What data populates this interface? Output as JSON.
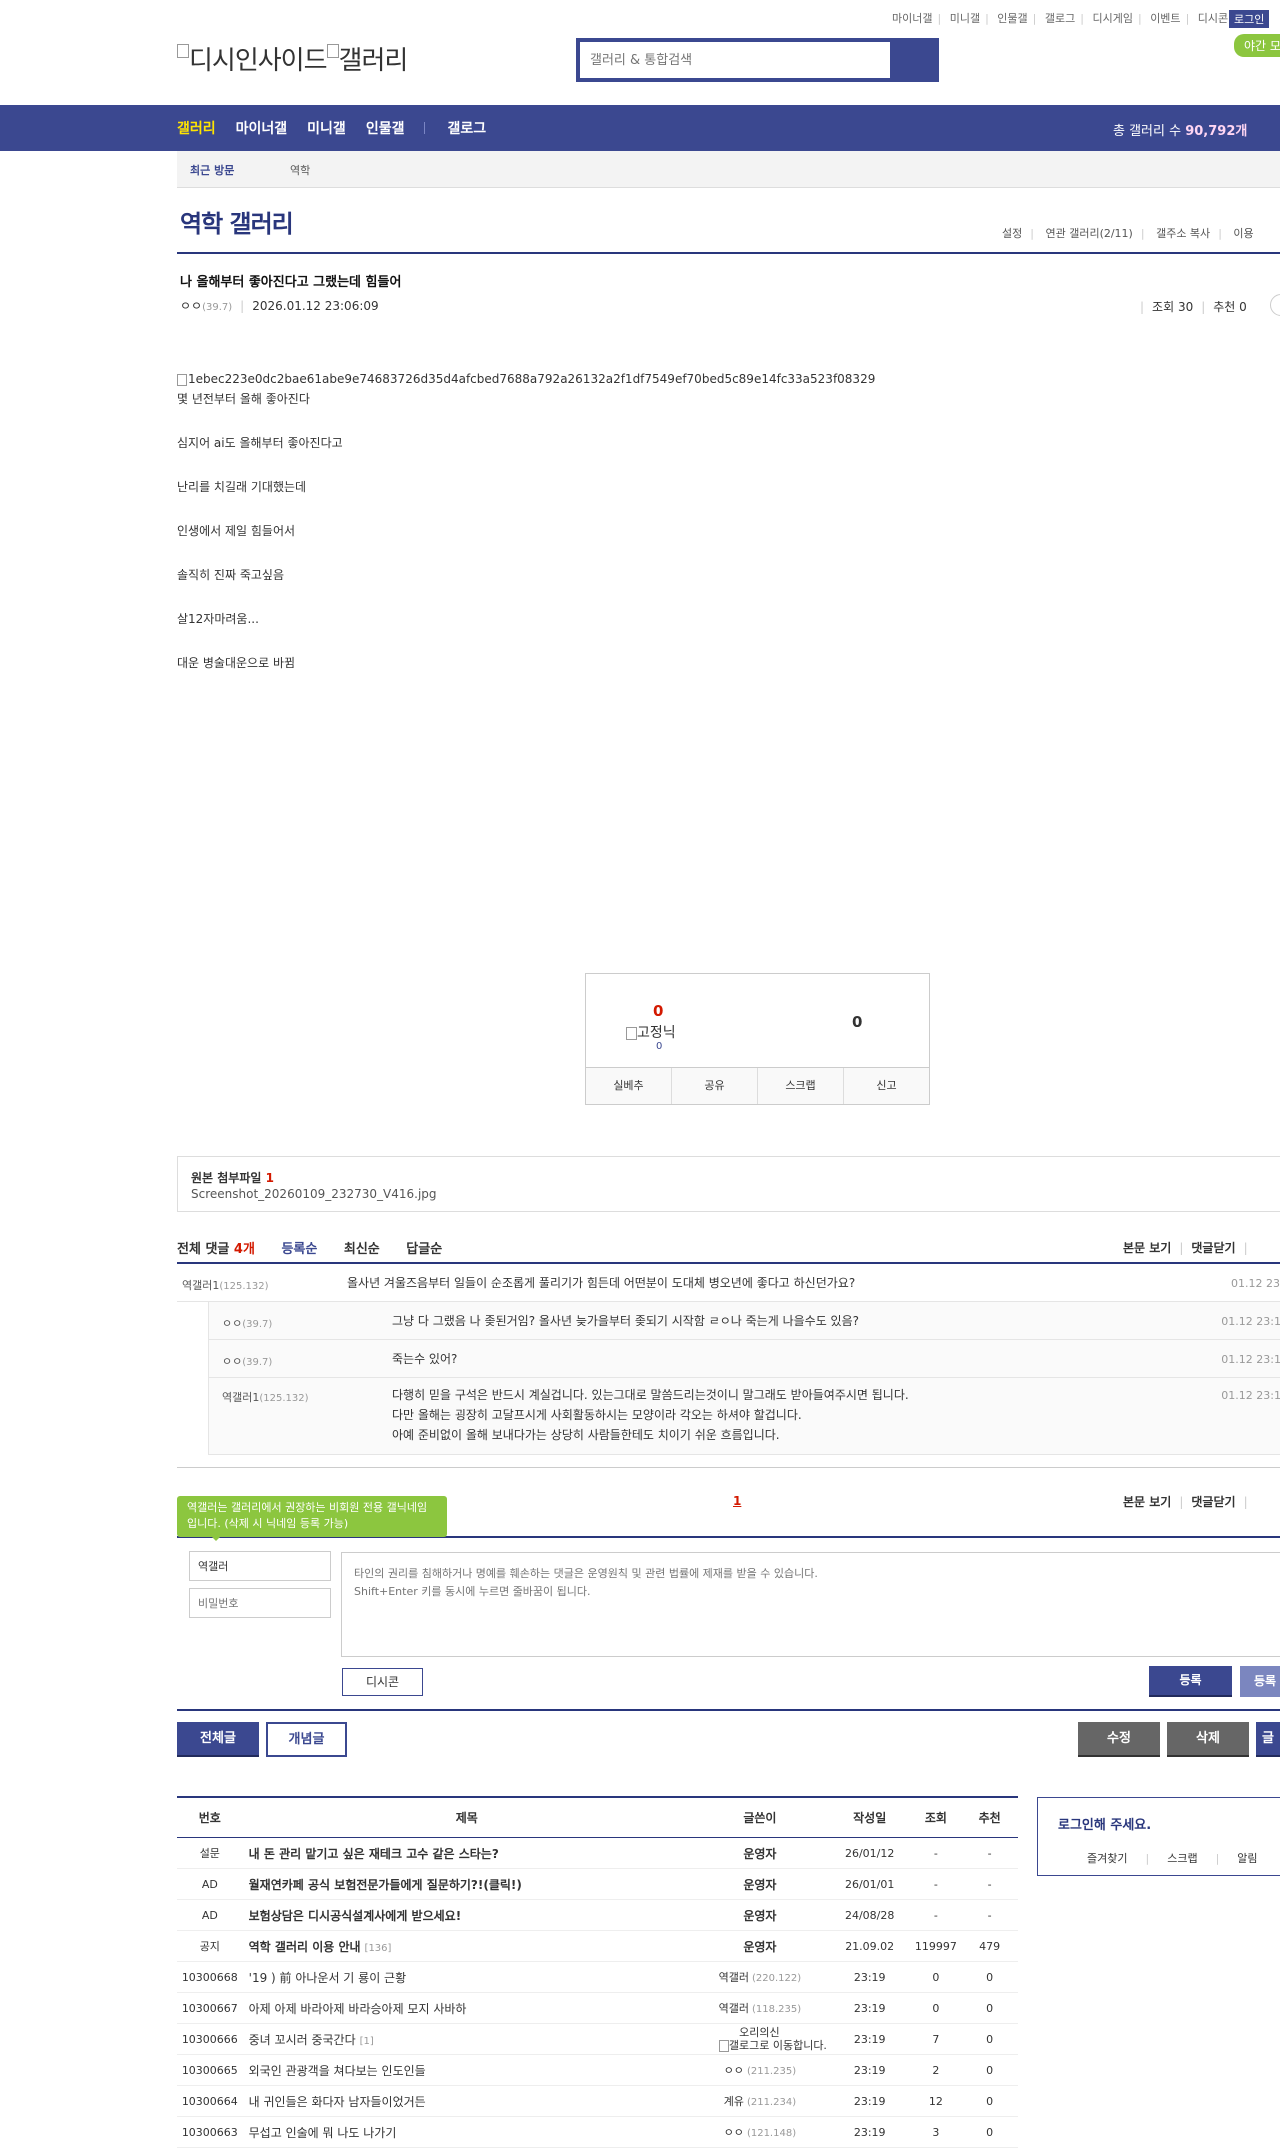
{
  "topnav": {
    "items": [
      "마이너갤",
      "미니갤",
      "인물갤",
      "갤로그",
      "디시게임",
      "이벤트",
      "디시콘"
    ],
    "login": "로그인",
    "night_mode": "야간 모드"
  },
  "logo": {
    "alt": "디시인사이드",
    "alt2": "갤러리"
  },
  "search": {
    "placeholder": "갤러리 & 통합검색"
  },
  "gnb": {
    "menu": [
      "갤러리",
      "마이너갤",
      "미니갤",
      "인물갤",
      "갤로그"
    ],
    "total_label": "총 갤러리 수",
    "total_value": "90,792개"
  },
  "recent": {
    "label": "최근 방문",
    "item": "역학"
  },
  "gallery": {
    "title": "역학 갤러리",
    "links": [
      "설정",
      "연관 갤러리(2/11)",
      "갤주소 복사",
      "이용"
    ]
  },
  "post": {
    "title": "나 올해부터 좋아진다고 그랬는데 힘들어",
    "writer": "ㅇㅇ",
    "writer_ip": "(39.7)",
    "datetime": "2026.01.12 23:06:09",
    "views": "조회 30",
    "recommends": "추천 0",
    "image_alt": "1ebec223e0dc2bae61abe9e74683726d35d4afcbed7688a792a26132a2f1df7549ef70bed5c89e14fc33a523f08329",
    "paragraphs": [
      "몇 년전부터 올해 좋아진다",
      "심지어 ai도 올해부터 좋아진다고",
      "난리를 치길래 기대했는데",
      "인생에서 제일 힘들어서",
      "솔직히 진짜 죽고싶음",
      "살12자마려움...",
      "대운 병술대운으로 바뀜"
    ]
  },
  "recommend": {
    "up_count": "0",
    "fixed_alt": "고정닉",
    "fixed_count": "0",
    "down_count": "0",
    "buttons": [
      "실베추",
      "공유",
      "스크랩",
      "신고"
    ]
  },
  "attachment": {
    "label": "원본 첨부파일",
    "count": "1",
    "filename": "Screenshot_20260109_232730_V416.jpg"
  },
  "comments_header": {
    "total_label": "전체 댓글",
    "total_count": "4개",
    "sorts": [
      "등록순",
      "최신순",
      "답글순"
    ],
    "right": [
      "본문 보기",
      "댓글닫기"
    ]
  },
  "comments": [
    {
      "nick": "역갤러1",
      "ip": "(125.132)",
      "text": "올사년 겨울즈음부터 일들이 순조롭게 풀리기가 힘든데 어떤분이 도대체 병오년에 좋다고 하신던가요?",
      "date": "01.12 23"
    },
    {
      "nick": "ㅇㅇ",
      "ip": "(39.7)",
      "text": "그냥 다 그랬음 나 좆된거임? 올사년 늦가을부터 좆되기 시작함 ㄹㅇ나 죽는게 나을수도 있음?",
      "date": "01.12 23:1"
    },
    {
      "nick": "ㅇㅇ",
      "ip": "(39.7)",
      "text": "죽는수 있어?",
      "date": "01.12 23:1"
    },
    {
      "nick": "역갤러1",
      "ip": "(125.132)",
      "lines": [
        "다행히 믿을 구석은 반드시 계실겁니다. 있는그대로 말씀드리는것이니 말그래도 받아들여주시면 됩니다.",
        "다만 올해는 굉장히 고달프시게 사회활동하시는 모양이라 각오는 하셔야 할겁니다.",
        "아예 준비없이 올해 보내다가는 상당히 사람들한테도 치이기 쉬운 흐름입니다."
      ],
      "date": "01.12 23:1"
    }
  ],
  "paging": "1",
  "write": {
    "tooltip": "역갤러는 갤러리에서 권장하는 비회원 전용 갤닉네임입니다. (삭제 시 닉네임 등록 가능)",
    "nick_value": "역갤러",
    "password_placeholder": "비밀번호",
    "textarea_placeholder": "타인의 권리를 침해하거나 명예를 훼손하는 댓글은 운영원칙 및 관련 법률에 제재를 받을 수 있습니다.\nShift+Enter 키를 동시에 누르면 줄바꿈이 됩니다.",
    "dccon": "디시콘",
    "submit": "등록",
    "submit2": "등록"
  },
  "bottom_buttons": {
    "all": "전체글",
    "concept": "개념글",
    "edit": "수정",
    "delete": "삭제",
    "write": "글"
  },
  "list": {
    "headers": [
      "번호",
      "제목",
      "글쓴이",
      "작성일",
      "조회",
      "추천"
    ],
    "rows": [
      {
        "no": "설문",
        "title": "내 돈 관리 맡기고 싶은 재테크 고수 같은 스타는?",
        "bold": true,
        "writer": "운영자",
        "writer_bold": true,
        "date": "26/01/12",
        "views": "-",
        "rec": "-"
      },
      {
        "no": "AD",
        "title": "월재연카페 공식 보험전문가들에게 질문하기?!(클릭!)",
        "bold": true,
        "writer": "운영자",
        "writer_bold": true,
        "date": "26/01/01",
        "views": "-",
        "rec": "-"
      },
      {
        "no": "AD",
        "title": "보험상담은 디시공식설계사에게 받으세요!",
        "bold": true,
        "writer": "운영자",
        "writer_bold": true,
        "date": "24/08/28",
        "views": "-",
        "rec": "-"
      },
      {
        "no": "공지",
        "title": "역학 갤러리 이용 안내",
        "reply": "[136]",
        "bold": true,
        "writer": "운영자",
        "writer_bold": true,
        "date": "21.09.02",
        "views": "119997",
        "rec": "479"
      },
      {
        "no": "10300668",
        "title": "'19 ) 前 아나운서 기 룡이 근황",
        "writer": "역갤러",
        "ip": "(220.122)",
        "date": "23:19",
        "views": "0",
        "rec": "0"
      },
      {
        "no": "10300667",
        "title": "아제 아제 바라아제 바라승아제 모지 사바하",
        "writer": "역갤러",
        "ip": "(118.235)",
        "date": "23:19",
        "views": "0",
        "rec": "0"
      },
      {
        "no": "10300666",
        "title": "중녀 꼬시러 중국간다",
        "reply": "[1]",
        "writer": "오리의신",
        "writer_sub": "갤로그로 이동합니다.",
        "date": "23:19",
        "views": "7",
        "rec": "0"
      },
      {
        "no": "10300665",
        "title": "외국인 관광객을 쳐다보는 인도인들",
        "writer": "ㅇㅇ",
        "ip": "(211.235)",
        "date": "23:19",
        "views": "2",
        "rec": "0"
      },
      {
        "no": "10300664",
        "title": "내 귀인들은 화다자 남자들이었거든",
        "writer": "계유",
        "ip": "(211.234)",
        "date": "23:19",
        "views": "12",
        "rec": "0"
      },
      {
        "no": "10300663",
        "title": "무섭고 인술에 뭐 나도 나가기",
        "writer": "ㅇㅇ",
        "ip": "(121.148)",
        "date": "23:19",
        "views": "3",
        "rec": "0"
      }
    ]
  },
  "login_box": {
    "title": "로그인해 주세요.",
    "links": [
      "즐겨찾기",
      "스크랩",
      "알림"
    ]
  },
  "colors": {
    "brand": "#3b4890",
    "accent_red": "#d31900",
    "green": "#8cc63f",
    "yellow": "#ffe400"
  }
}
